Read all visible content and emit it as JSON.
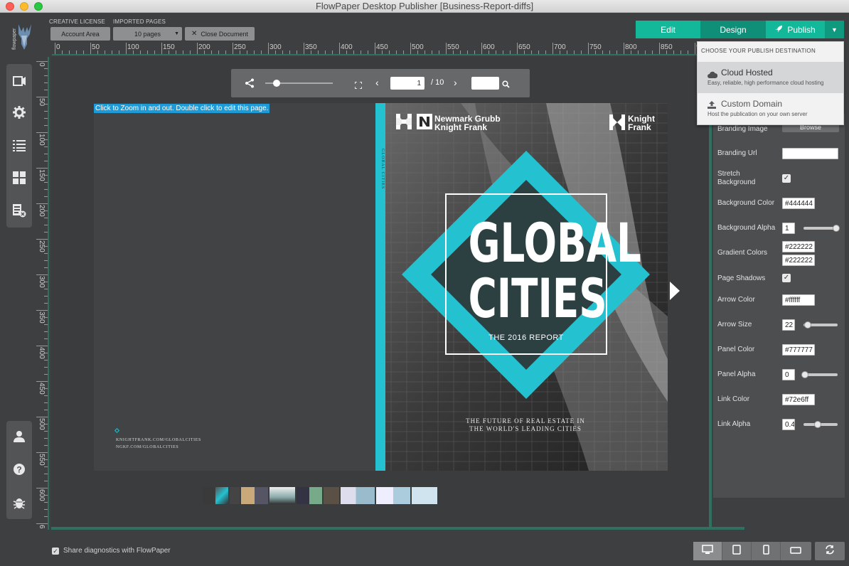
{
  "window": {
    "title": "FlowPaper Desktop Publisher [Business-Report-diffs]"
  },
  "brand": {
    "logo_text": "flowpaper"
  },
  "topbar": {
    "license_label": "CREATIVE LICENSE",
    "account_button": "Account Area",
    "imported_label": "IMPORTED PAGES",
    "pages_select": "10 pages",
    "close_button": "Close Document"
  },
  "modes": {
    "edit": "Edit",
    "design": "Design",
    "publish": "Publish"
  },
  "ruler": {
    "h": [
      "0",
      "50",
      "100",
      "150",
      "200",
      "250",
      "300",
      "350",
      "400",
      "450",
      "500",
      "550",
      "600",
      "650",
      "700",
      "750",
      "800",
      "850",
      "9"
    ],
    "v": [
      "0",
      "50",
      "100",
      "150",
      "200",
      "250",
      "300",
      "350",
      "400",
      "450",
      "500",
      "550",
      "600",
      "6"
    ]
  },
  "viewer": {
    "page_current": "1",
    "page_total": "/ 10",
    "search_value": "",
    "hint": "Click to Zoom in and out. Double click to edit this page."
  },
  "left_page": {
    "url1": "KNIGHTFRANK.COM/GLOBALCITIES",
    "url2": "NGKF.COM/GLOBALCITIES"
  },
  "cover": {
    "brand_left_line1": "Newmark Grubb",
    "brand_left_line2": "Knight Frank",
    "brand_right_line1": "Knight",
    "brand_right_line2": "Frank",
    "spine_text": "GLOBAL CITIES",
    "headline1": "GLOBAL",
    "headline2": "CITIES",
    "report": "THE 2016 REPORT",
    "tagline1": "THE FUTURE OF REAL ESTATE IN",
    "tagline2": "THE WORLD'S LEADING CITIES"
  },
  "publish_menu": {
    "heading": "CHOOSE YOUR PUBLISH DESTINATION",
    "items": [
      {
        "title": "Cloud Hosted",
        "desc": "Easy, reliable, high performance cloud hosting"
      },
      {
        "title": "Custom Domain",
        "desc": "Host the publication on your own server"
      }
    ]
  },
  "settings": {
    "branding_image": "Branding Image",
    "browse": "Browse",
    "branding_url": "Branding Url",
    "branding_url_value": "",
    "stretch_bg_1": "Stretch",
    "stretch_bg_2": "Background",
    "bg_color": "Background Color",
    "bg_color_value": "#444444",
    "bg_alpha": "Background Alpha",
    "bg_alpha_value": "1",
    "gradient": "Gradient Colors",
    "gradient_value1": "#222222",
    "gradient_value2": "#222222",
    "page_shadows": "Page Shadows",
    "arrow_color": "Arrow Color",
    "arrow_color_value": "#ffffff",
    "arrow_size": "Arrow Size",
    "arrow_size_value": "22",
    "panel_color": "Panel Color",
    "panel_color_value": "#777777",
    "panel_alpha": "Panel Alpha",
    "panel_alpha_value": "0",
    "link_color": "Link Color",
    "link_color_value": "#72e6ff",
    "link_alpha": "Link Alpha",
    "link_alpha_value": "0.4"
  },
  "footer": {
    "diagnostics": "Share diagnostics with FlowPaper"
  }
}
